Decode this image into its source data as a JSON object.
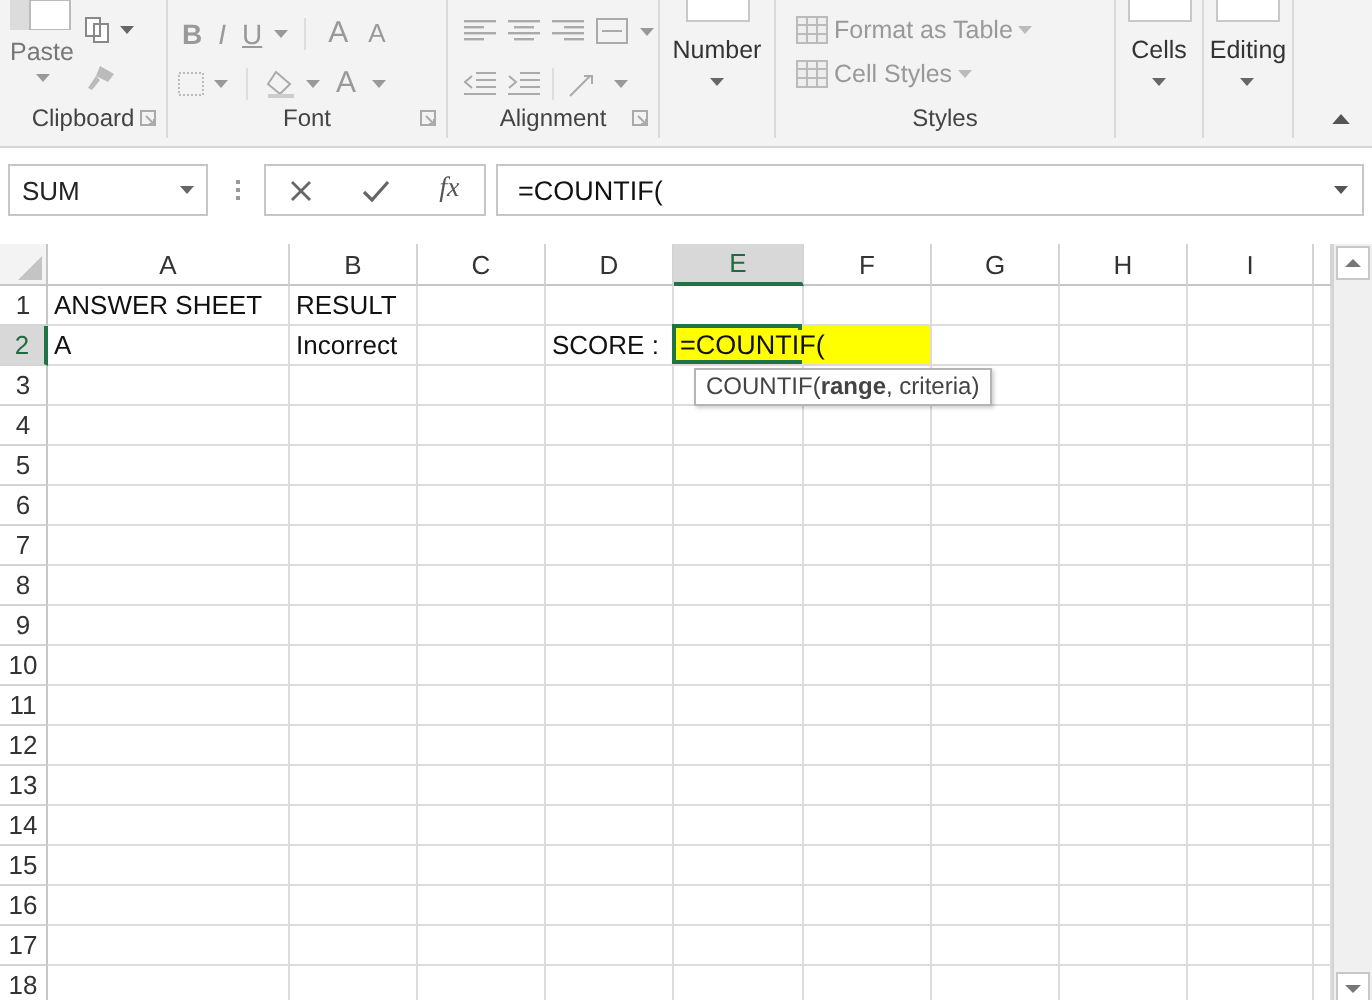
{
  "ribbon": {
    "clipboard": {
      "label": "Clipboard",
      "paste": "Paste"
    },
    "font": {
      "label": "Font",
      "style_buttons": [
        "B",
        "I",
        "U"
      ],
      "size_buttons": [
        "A",
        "A"
      ],
      "color_button": "A"
    },
    "alignment": {
      "label": "Alignment"
    },
    "number": {
      "button": "Number"
    },
    "styles": {
      "label": "Styles",
      "buttons": [
        "Format as Table",
        "Cell Styles"
      ]
    },
    "cells": {
      "button": "Cells"
    },
    "editing": {
      "button": "Editing"
    }
  },
  "formula_bar": {
    "name_box": "SUM",
    "function_label": "fx",
    "formula": "=COUNTIF("
  },
  "sheet": {
    "columns": [
      {
        "label": "A",
        "selected": false
      },
      {
        "label": "B",
        "selected": false
      },
      {
        "label": "C",
        "selected": false
      },
      {
        "label": "D",
        "selected": false
      },
      {
        "label": "E",
        "selected": true
      },
      {
        "label": "F",
        "selected": false
      },
      {
        "label": "G",
        "selected": false
      },
      {
        "label": "H",
        "selected": false
      },
      {
        "label": "I",
        "selected": false
      }
    ],
    "rows": [
      {
        "label": "1",
        "selected": false,
        "cells": [
          {
            "kind": "text",
            "text": "ANSWER SHEET"
          },
          {
            "kind": "text",
            "text": "RESULT"
          }
        ]
      },
      {
        "label": "2",
        "selected": true,
        "cells": [
          {
            "kind": "text",
            "text": "A"
          },
          {
            "kind": "text",
            "text": "Incorrect"
          },
          {
            "kind": "text",
            "text": ""
          },
          {
            "kind": "text",
            "text": "SCORE :"
          },
          {
            "kind": "editing",
            "text": "=COUNTIF(",
            "tooltip": "COUNTIF(**range**, criteria)"
          }
        ]
      },
      {
        "label": "3",
        "selected": false,
        "cells": []
      },
      {
        "label": "4",
        "selected": false,
        "cells": []
      },
      {
        "label": "5",
        "selected": false,
        "cells": []
      },
      {
        "label": "6",
        "selected": false,
        "cells": []
      },
      {
        "label": "7",
        "selected": false,
        "cells": []
      },
      {
        "label": "8",
        "selected": false,
        "cells": []
      },
      {
        "label": "9",
        "selected": false,
        "cells": []
      },
      {
        "label": "10",
        "selected": false,
        "cells": []
      },
      {
        "label": "11",
        "selected": false,
        "cells": []
      },
      {
        "label": "12",
        "selected": false,
        "cells": []
      },
      {
        "label": "13",
        "selected": false,
        "cells": []
      },
      {
        "label": "14",
        "selected": false,
        "cells": []
      },
      {
        "label": "15",
        "selected": false,
        "cells": []
      },
      {
        "label": "16",
        "selected": false,
        "cells": []
      },
      {
        "label": "17",
        "selected": false,
        "cells": []
      },
      {
        "label": "18",
        "selected": false,
        "cells": []
      }
    ]
  }
}
